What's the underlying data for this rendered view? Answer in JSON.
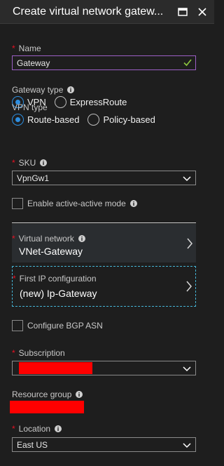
{
  "header": {
    "title": "Create virtual network gatew...",
    "maximize_icon": "maximize-icon",
    "close_icon": "close-icon"
  },
  "form": {
    "name": {
      "label": "Name",
      "required": true,
      "value": "Gateway",
      "valid": true
    },
    "gateway_type": {
      "label": "Gateway type",
      "options": [
        "VPN",
        "ExpressRoute"
      ],
      "selected": "VPN"
    },
    "vpn_type": {
      "label": "VPN type",
      "options": [
        "Route-based",
        "Policy-based"
      ],
      "selected": "Route-based"
    },
    "sku": {
      "label": "SKU",
      "required": true,
      "value": "VpnGw1"
    },
    "active_active": {
      "label": "Enable active-active mode",
      "checked": false
    },
    "virtual_network": {
      "label": "Virtual network",
      "required": true,
      "value": "VNet-Gateway"
    },
    "ip_configuration": {
      "label": "First IP configuration",
      "required": true,
      "value": "(new) Ip-Gateway"
    },
    "bgp": {
      "label": "Configure BGP ASN",
      "checked": false
    },
    "subscription": {
      "label": "Subscription",
      "required": true,
      "value": ""
    },
    "resource_group": {
      "label": "Resource group",
      "value": ""
    },
    "location": {
      "label": "Location",
      "required": true,
      "value": "East US"
    }
  },
  "colors": {
    "background": "#1e1e1e",
    "accent_blue": "#2d8ee0",
    "required_red": "#e81123",
    "focus_purple": "#9c5fc6",
    "dashed_cyan": "#45b5d6",
    "redaction": "#ff0000"
  }
}
